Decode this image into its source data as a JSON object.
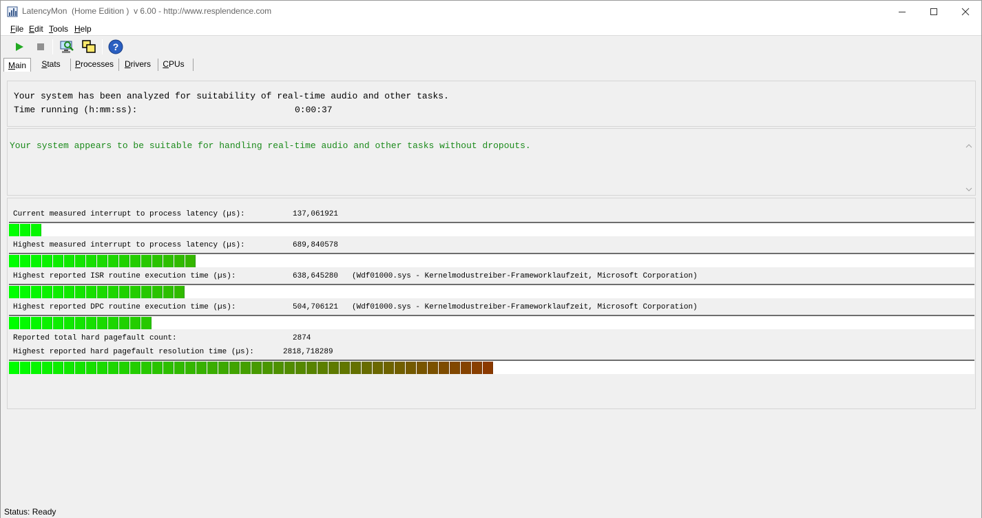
{
  "window": {
    "title": "LatencyMon  (Home Edition )  v 6.00 - http://www.resplendence.com",
    "app_icon": "latencymon-app-icon",
    "controls": {
      "minimize": "minimize-icon",
      "maximize": "maximize-icon",
      "close": "close-icon"
    }
  },
  "menu": [
    {
      "id": "file",
      "accel": "F",
      "rest": "ile"
    },
    {
      "id": "edit",
      "accel": "E",
      "rest": "dit"
    },
    {
      "id": "tools",
      "accel": "T",
      "rest": "ools"
    },
    {
      "id": "help",
      "accel": "H",
      "rest": "elp"
    }
  ],
  "toolbar": {
    "buttons": [
      "play-icon",
      "stop-icon",
      "computer-analyze-icon",
      "windows-icon",
      "help-icon"
    ],
    "colors": {
      "play": "#22aa22",
      "stop": "#909090",
      "help": "#2a5fc1"
    }
  },
  "tabs": [
    {
      "id": "main",
      "accel": "M",
      "rest": "ain",
      "active": true
    },
    {
      "id": "stats",
      "accel": "S",
      "rest": "tats",
      "active": false
    },
    {
      "id": "processes",
      "accel": "P",
      "rest": "rocesses",
      "active": false
    },
    {
      "id": "drivers",
      "accel": "D",
      "rest": "rivers",
      "active": false
    },
    {
      "id": "cpus",
      "accel": "C",
      "rest": "PUs",
      "active": false
    }
  ],
  "summary": {
    "line1": "Your system has been analyzed for suitability of real-time audio and other tasks.",
    "time_label": "Time running (h:mm:ss):",
    "time_value": "0:00:37"
  },
  "verdict": {
    "text": "Your system appears to be suitable for handling real-time audio and other tasks without dropouts.",
    "color": "#1a8a1a"
  },
  "metrics": [
    {
      "label": "Current measured interrupt to process latency (µs):",
      "value": "137,061921",
      "extra": "",
      "segments": 3
    },
    {
      "label": "Highest measured interrupt to process latency (µs):",
      "value": "689,840578",
      "extra": "",
      "segments": 17
    },
    {
      "label": "Highest reported ISR routine execution time (µs):",
      "value": "638,645280",
      "extra": "(Wdf01000.sys - Kernelmodustreiber-Frameworklaufzeit, Microsoft Corporation)",
      "segments": 16
    },
    {
      "label": "Highest reported DPC routine execution time (µs):",
      "value": "504,706121",
      "extra": "(Wdf01000.sys - Kernelmodustreiber-Frameworklaufzeit, Microsoft Corporation)",
      "segments": 13
    },
    {
      "label": "Reported total hard pagefault count:",
      "value": "2874",
      "extra": "",
      "segments": null
    },
    {
      "label": "Highest reported hard pagefault resolution time (µs):",
      "value": "2818,718289",
      "extra": "",
      "segments": 44
    }
  ],
  "meter_colors": {
    "low": "#00ff00",
    "high": "#8b3a00"
  },
  "status": "Status: Ready"
}
